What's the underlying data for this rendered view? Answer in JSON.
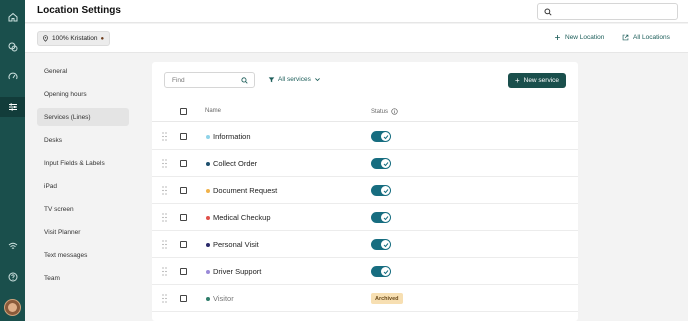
{
  "colors": {
    "brand": "#1a4f4c",
    "toggle_on": "#176d80",
    "archived_badge_bg": "#f7dfb2"
  },
  "rail": {
    "icons": [
      "home-icon",
      "chat-bubbles-icon",
      "gauge-icon",
      "sliders-icon",
      "wifi-icon",
      "help-icon"
    ],
    "active": "sliders-icon"
  },
  "header": {
    "title": "Location Settings",
    "search_value": ""
  },
  "subheader": {
    "location_chip": "100% Kristation",
    "new_location": "New Location",
    "all_locations": "All Locations"
  },
  "sidebar": {
    "items": [
      {
        "label": "General"
      },
      {
        "label": "Opening hours"
      },
      {
        "label": "Services (Lines)",
        "active": true
      },
      {
        "label": "Desks"
      },
      {
        "label": "Input Fields & Labels"
      },
      {
        "label": "iPad"
      },
      {
        "label": "TV screen"
      },
      {
        "label": "Visit Planner"
      },
      {
        "label": "Text messages"
      },
      {
        "label": "Team"
      }
    ]
  },
  "main": {
    "find_placeholder": "Find",
    "filter_label": "All services",
    "new_service_label": "New service",
    "columns": {
      "name": "Name",
      "status": "Status"
    },
    "rows": [
      {
        "name": "Information",
        "dot_color": "#8fd3e8",
        "status": "on"
      },
      {
        "name": "Collect Order",
        "dot_color": "#1d4f6e",
        "status": "on"
      },
      {
        "name": "Document Request",
        "dot_color": "#f0b24a",
        "status": "on"
      },
      {
        "name": "Medical Checkup",
        "dot_color": "#e0504a",
        "status": "on"
      },
      {
        "name": "Personal Visit",
        "dot_color": "#2a2a6a",
        "status": "on"
      },
      {
        "name": "Driver Support",
        "dot_color": "#9a8ad8",
        "status": "on"
      },
      {
        "name": "Visitor",
        "dot_color": "#2f7d6a",
        "status": "archived",
        "badge": "Archived"
      }
    ]
  }
}
